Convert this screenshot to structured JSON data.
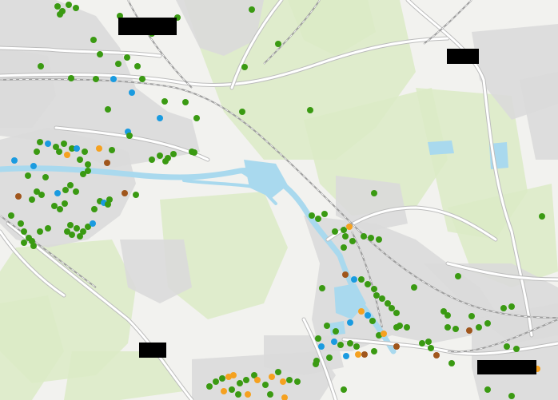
{
  "map": {
    "colors": {
      "background": "#f2f2ef",
      "urban": "#dadada",
      "green_area": "#dcebc6",
      "water": "#a9d9ee",
      "road_major": "#ffffff",
      "road_casing": "#bdbdbd",
      "railway": "#9e9e9e",
      "redaction": "#000000"
    },
    "marker_colors": {
      "green": "#3a9a12",
      "blue": "#1a9be0",
      "orange": "#f5a11f",
      "brown": "#a0561c"
    },
    "redacted_labels": [
      "redacted",
      "redacted",
      "redacted",
      "redacted"
    ]
  }
}
